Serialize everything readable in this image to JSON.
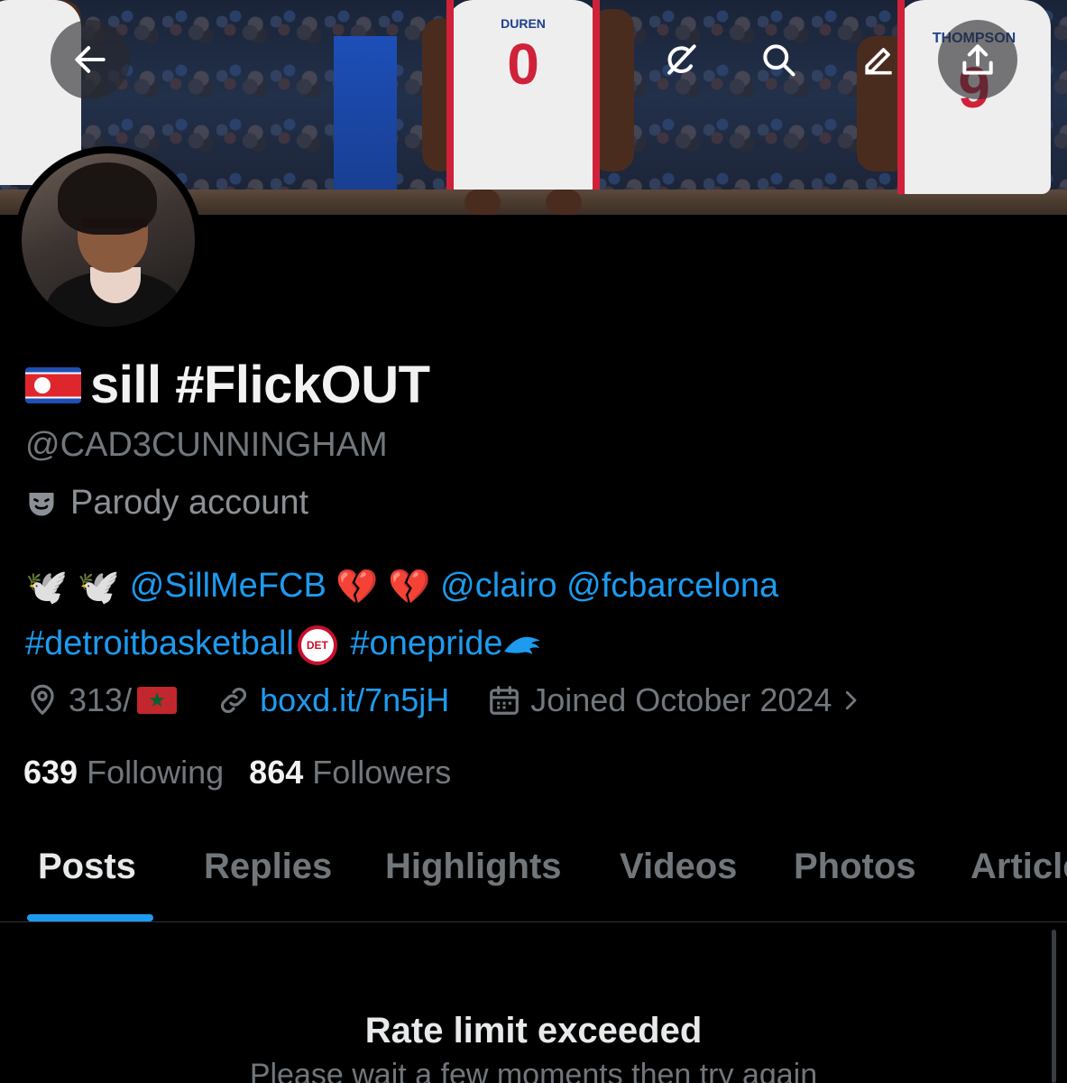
{
  "profile": {
    "display_name": "sill #FlickOUT",
    "handle": "@CAD3CUNNINGHAM",
    "parody_label": "Parody account",
    "bio": {
      "mention_1": "@SillMeFCB",
      "mention_2": "@clairo",
      "mention_3": "@fcbarcelona",
      "hashtag_1": "#detroitbasketball",
      "hashtag_2": "#onepride",
      "pistons_logo_text": "DET"
    },
    "location": "313/",
    "website": "boxd.it/7n5jH",
    "joined": "Joined October 2024",
    "following_count": "639",
    "following_label": "Following",
    "followers_count": "864",
    "followers_label": "Followers"
  },
  "banner": {
    "jersey_numbers": [
      "0",
      "9"
    ],
    "jersey_names": [
      "DUREN",
      "THOMPSON"
    ]
  },
  "tabs": [
    "Posts",
    "Replies",
    "Highlights",
    "Videos",
    "Photos",
    "Articles"
  ],
  "active_tab": "Posts",
  "content": {
    "title": "Rate limit exceeded",
    "subtitle": "Please wait a few moments then try again"
  },
  "icons": {
    "back": "back-arrow-icon",
    "grok": "grok-icon",
    "search": "search-icon",
    "edit": "edit-icon",
    "share": "share-icon",
    "location": "location-pin-icon",
    "link": "link-icon",
    "calendar": "calendar-icon"
  },
  "colors": {
    "accent": "#1d9bf0",
    "background": "#000000",
    "secondary_text": "#72777d"
  }
}
